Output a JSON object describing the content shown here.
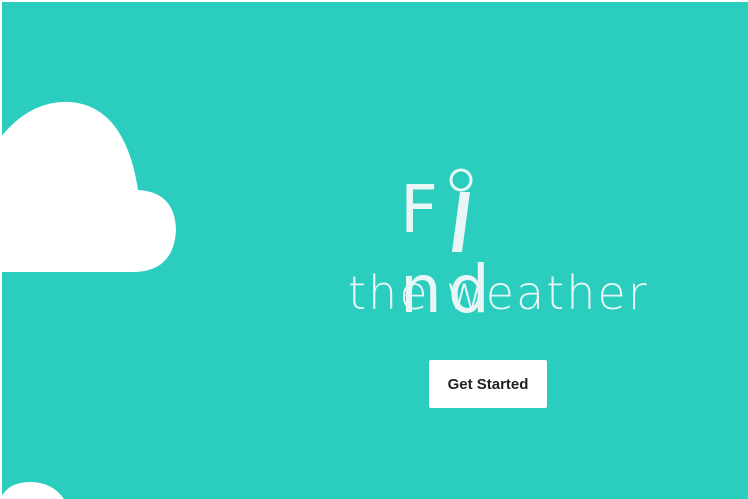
{
  "hero": {
    "title_f": "F",
    "title_rest": "nd",
    "subtitle": "the weather",
    "cta_label": "Get Started"
  },
  "icons": {
    "cloud": "cloud-icon",
    "title_i": "magnifier-i-icon"
  },
  "colors": {
    "background": "#2bcdbf",
    "text": "#e8f6f6",
    "cloud": "#ffffff",
    "button_bg": "#ffffff",
    "button_text": "#222222"
  }
}
